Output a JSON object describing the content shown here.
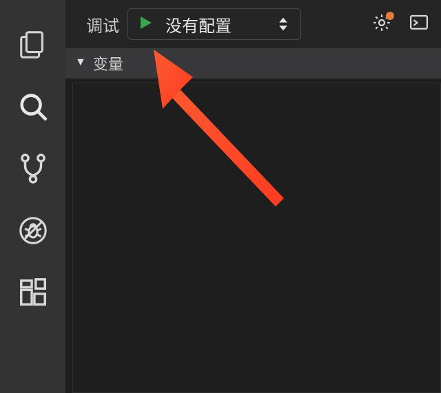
{
  "activity": {
    "explorer": "explorer",
    "search": "search",
    "scm": "source-control",
    "debug": "debug",
    "extensions": "extensions"
  },
  "toolbar": {
    "title": "调试",
    "config_selected": "没有配置",
    "play": "start-debugging",
    "settings": "settings",
    "console": "debug-console"
  },
  "panels": {
    "variables": {
      "title": "变量"
    }
  },
  "colors": {
    "play_green": "#3fa34d",
    "badge_orange": "#e07b3c",
    "arrow_red": "#ff4a28"
  }
}
